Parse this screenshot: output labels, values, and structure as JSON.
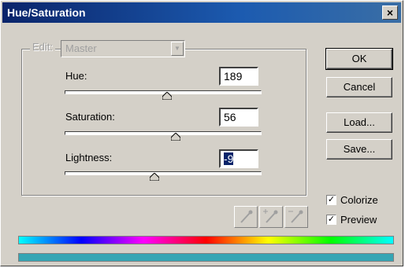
{
  "window": {
    "title": "Hue/Saturation",
    "close_glyph": "×"
  },
  "edit": {
    "label": "Edit:",
    "selected": "Master",
    "arrow_glyph": "▼"
  },
  "sliders": [
    {
      "label": "Hue:",
      "value": "189"
    },
    {
      "label": "Saturation:",
      "value": "56"
    },
    {
      "label": "Lightness:",
      "value": "-9"
    }
  ],
  "buttons": {
    "ok": "OK",
    "cancel": "Cancel",
    "load": "Load...",
    "save": "Save..."
  },
  "checkboxes": [
    {
      "label": "Colorize",
      "checked": true,
      "glyph": "✓"
    },
    {
      "label": "Preview",
      "checked": true,
      "glyph": "✓"
    }
  ],
  "colors": {
    "spectrum_bottom": "#35a5b4",
    "selection": "#0a246a"
  }
}
